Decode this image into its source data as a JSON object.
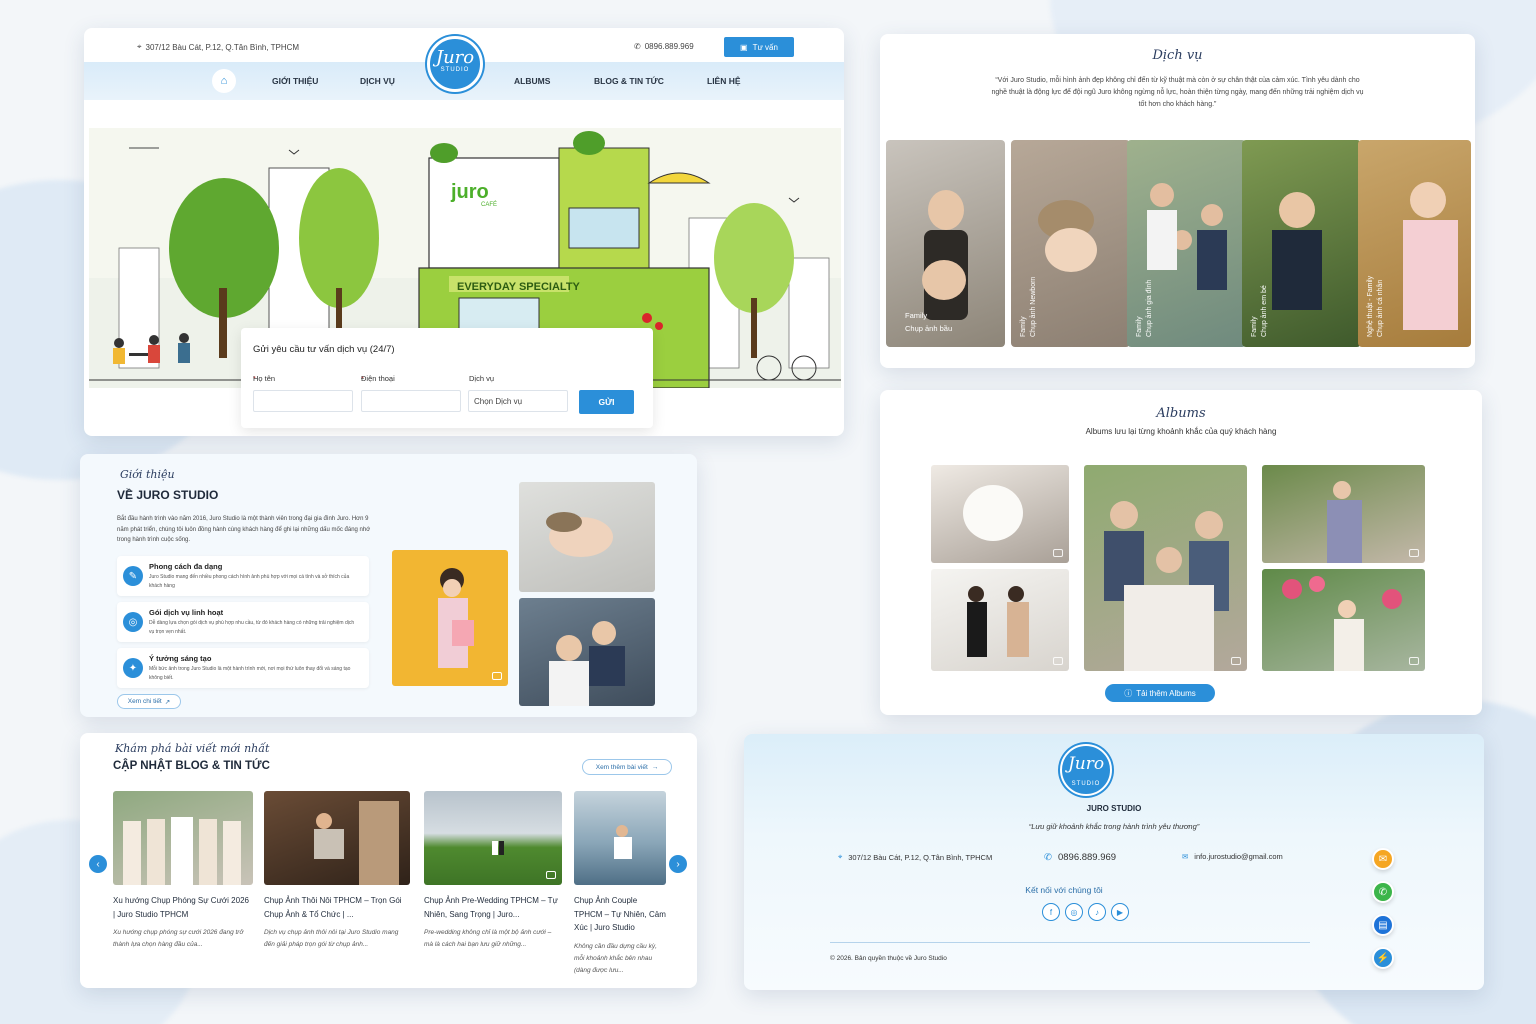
{
  "header": {
    "address": "307/12 Bàu Cát, P.12, Q.Tân Bình, TPHCM",
    "phone": "0896.889.969",
    "consult_button": "Tư vấn",
    "logo_text": "Juro",
    "logo_sub": "STUDIO"
  },
  "nav": {
    "items": [
      "GIỚI THIỆU",
      "DỊCH VỤ",
      "ALBUMS",
      "BLOG & TIN TỨC",
      "LIÊN HỆ"
    ]
  },
  "hero": {
    "form_title": "Gửi yêu cầu tư vấn dịch vụ (24/7)",
    "label_name": "Họ tên",
    "label_phone": "Điện thoại",
    "label_service": "Dịch vụ",
    "service_placeholder": "Chọn Dịch vụ",
    "submit": "GỬI",
    "sign_cafe": "juro",
    "sign_cafe_sub": "CAFÉ",
    "sign_specialty": "EVERYDAY SPECIALTY"
  },
  "services": {
    "script_title": "Dịch vụ",
    "quote": "“Với Juro Studio, mỗi hình ảnh đẹp không chỉ đến từ kỹ thuật mà còn ở sự chân thật của cảm xúc. Tình yêu dành cho nghề thuật là động lực để đội ngũ Juro không ngừng nỗ lực, hoàn thiện từng ngày, mang đến những trải nghiệm dịch vụ tốt hơn cho khách hàng.”",
    "cards": [
      {
        "line1": "Family",
        "line2": "Chụp ảnh bầu"
      },
      {
        "line1": "Family",
        "line2": "Chụp ảnh Newborn"
      },
      {
        "line1": "Family",
        "line2": "Chụp ảnh gia đình"
      },
      {
        "line1": "Family",
        "line2": "Chụp ảnh em bé"
      },
      {
        "line1": "Nghệ thuật - Family",
        "line2": "Chụp ảnh cá nhân"
      }
    ]
  },
  "albums": {
    "script_title": "Albums",
    "subtitle": "Albums lưu lại từng khoảnh khắc của quý khách hàng",
    "more_button": "Tải thêm Albums"
  },
  "intro": {
    "script_title": "Giới thiệu",
    "title": "VỀ JURO STUDIO",
    "paragraph": "Bắt đầu hành trình vào năm 2016, Juro Studio là một thành viên trong đại gia đình Juro. Hơn 9 năm phát triển, chúng tôi luôn đồng hành cùng khách hàng để ghi lại những dấu mốc đáng nhớ trong hành trình cuộc sống.",
    "features": [
      {
        "title": "Phong cách đa dạng",
        "desc": "Juro Studio mang đến nhiều phong cách hình ảnh phù hợp với mọi cá tính và sở thích của khách hàng"
      },
      {
        "title": "Gói dịch vụ linh hoạt",
        "desc": "Dễ dàng lựa chọn gói dịch vụ phù hợp nhu cầu, từ đó khách hàng có những trải nghiệm dịch vụ trọn vẹn nhất."
      },
      {
        "title": "Ý tưởng sáng tạo",
        "desc": "Mỗi bức ảnh trong Juro Studio là một hành trình mới, nơi mọi thứ luôn thay đổi và sáng tạo không biết."
      }
    ],
    "more_button": "Xem chi tiết"
  },
  "blog": {
    "script_title": "Khám phá bài viết mới nhất",
    "title": "CẬP NHẬT BLOG & TIN TỨC",
    "more_button": "Xem thêm bài viết",
    "posts": [
      {
        "title": "Xu hướng Chụp Phóng Sự Cưới 2026 | Juro Studio TPHCM",
        "excerpt": "Xu hướng chụp phóng sự cưới 2026 đang trở thành lựa chọn hàng đầu của..."
      },
      {
        "title": "Chụp Ảnh Thôi Nôi TPHCM – Trọn Gói Chụp Ảnh & Tổ Chức | ...",
        "excerpt": "Dịch vụ chụp ảnh thôi nôi tại Juro Studio mang đến giải pháp trọn gói từ chụp ảnh..."
      },
      {
        "title": "Chụp Ảnh Pre-Wedding TPHCM – Tự Nhiên, Sang Trọng | Juro...",
        "excerpt": "Pre-wedding không chỉ là một bộ ảnh cưới – mà là cách hai bạn lưu giữ những..."
      },
      {
        "title": "Chụp Ảnh Couple TPHCM – Tự Nhiên, Cảm Xúc | Juro Studio",
        "excerpt": "Không cần đầu dựng cầu kỳ, mỗi khoảnh khắc bên nhau (dàng được lưu..."
      }
    ]
  },
  "footer": {
    "logo_text": "Juro",
    "logo_sub": "STUDIO",
    "name": "JURO STUDIO",
    "slogan": "“Lưu giữ khoảnh khắc trong hành trình yêu thương”",
    "address": "307/12 Bàu Cát, P.12, Q.Tân Bình, TPHCM",
    "phone": "0896.889.969",
    "email": "info.jurostudio@gmail.com",
    "connect": "Kết nối với chúng tôi",
    "copyright": "© 2026. Bản quyền thuộc về Juro Studio"
  },
  "colors": {
    "accent": "#2b8fd9"
  }
}
